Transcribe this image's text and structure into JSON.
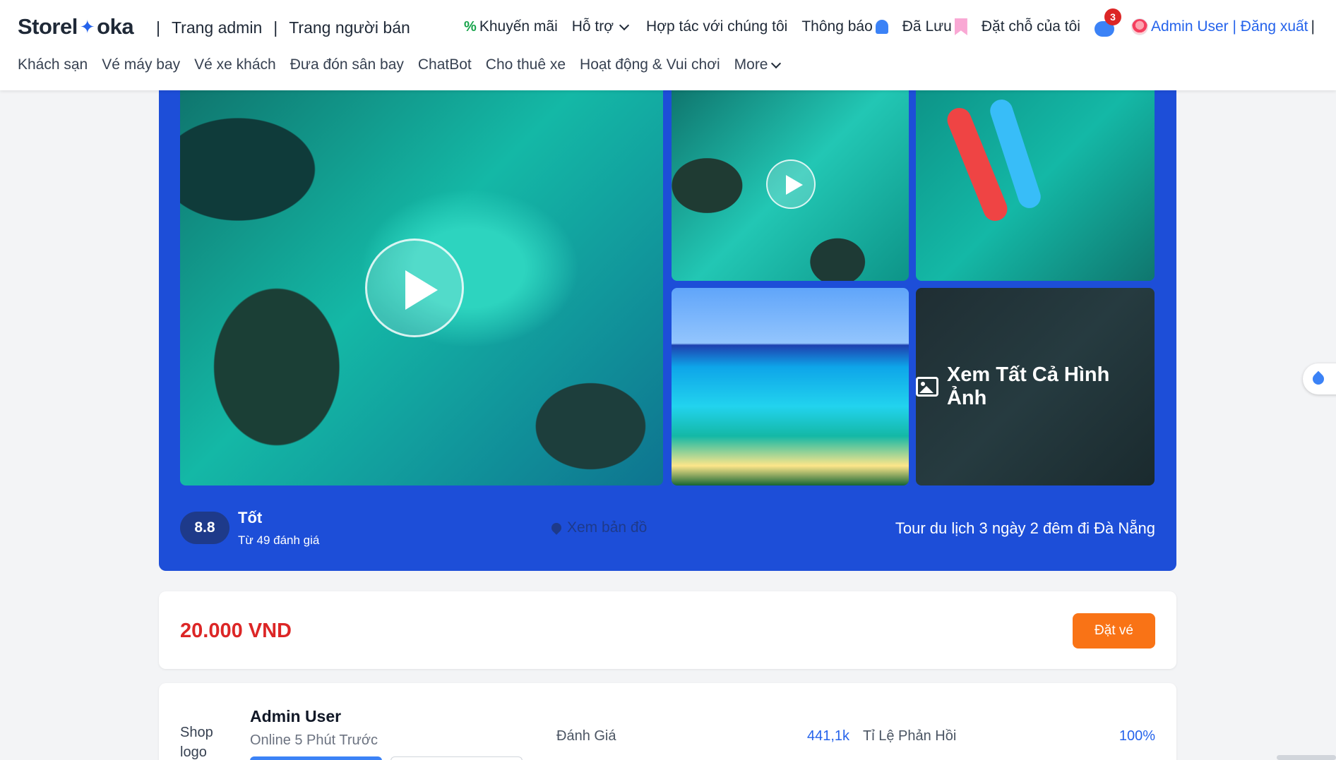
{
  "header": {
    "brand_left": "Storel",
    "brand_right": "oka",
    "brand_icon": "bird-icon",
    "admin_link": "Trang admin",
    "seller_link": "Trang người bán",
    "separator": "|",
    "nav": {
      "promo": "Khuyến mãi",
      "support": "Hỗ trợ",
      "partner": "Hợp tác với chúng tôi",
      "notifications": "Thông báo",
      "saved": "Đã Lưu",
      "bookings": "Đặt chỗ của tôi",
      "chat_badge": "3",
      "user": "Admin User | Đăng xuất",
      "trailing_sep": "|"
    },
    "sub_nav": [
      "Khách sạn",
      "Vé máy bay",
      "Vé xe khách",
      "Đưa đón sân bay",
      "ChatBot",
      "Cho thuê xe",
      "Hoạt động & Vui chơi",
      "More"
    ]
  },
  "gallery": {
    "see_all": "Xem Tất Cả Hình Ảnh",
    "rating_score": "8.8",
    "rating_word": "Tốt",
    "rating_count": "Từ 49 đánh giá",
    "map_link": "Xem bản đồ",
    "tour_title": "Tour du lịch 3 ngày 2 đêm đi Đà Nẵng"
  },
  "booking": {
    "price": "20.000 VND",
    "book_button": "Đặt vé"
  },
  "shop": {
    "logo_alt": "Shop logo",
    "name": "Admin User",
    "online": "Online 5 Phút Trước",
    "stat1_label": "Đánh Giá",
    "stat1_value": "441,1k",
    "stat2_label": "Tỉ Lệ Phản Hồi",
    "stat2_value": "100%"
  },
  "colors": {
    "primary_blue": "#1d4ed8",
    "price_red": "#dc2626",
    "book_orange": "#f97316",
    "link_blue": "#2563eb"
  }
}
